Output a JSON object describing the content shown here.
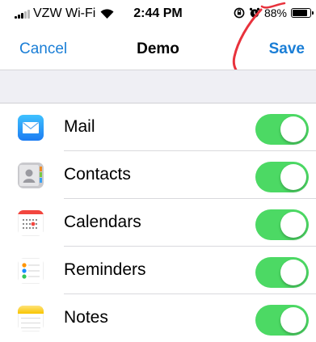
{
  "status_bar": {
    "carrier": "VZW Wi-Fi",
    "time": "2:44 PM",
    "battery": "88%",
    "battery_level": 0.88
  },
  "nav": {
    "cancel_label": "Cancel",
    "title": "Demo",
    "save_label": "Save"
  },
  "colors": {
    "accent": "#1a7ed6",
    "toggle_on": "#4cd964",
    "annotation": "#e8323c"
  },
  "items": [
    {
      "label": "Mail",
      "icon": "mail-icon",
      "enabled": true
    },
    {
      "label": "Contacts",
      "icon": "contacts-icon",
      "enabled": true
    },
    {
      "label": "Calendars",
      "icon": "calendar-icon",
      "enabled": true
    },
    {
      "label": "Reminders",
      "icon": "reminders-icon",
      "enabled": true
    },
    {
      "label": "Notes",
      "icon": "notes-icon",
      "enabled": true
    }
  ]
}
